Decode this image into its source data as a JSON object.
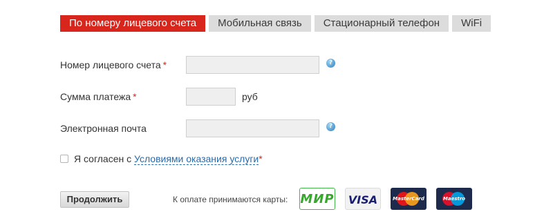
{
  "tabs": [
    {
      "label": "По номеру лицевого счета",
      "active": true
    },
    {
      "label": "Мобильная связь",
      "active": false
    },
    {
      "label": "Стационарный телефон",
      "active": false
    },
    {
      "label": "WiFi",
      "active": false
    }
  ],
  "form": {
    "account": {
      "label": "Номер лицевого счета",
      "required": "*",
      "value": ""
    },
    "amount": {
      "label": "Сумма платежа",
      "required": "*",
      "value": "",
      "unit": "руб"
    },
    "email": {
      "label": "Электронная почта",
      "value": ""
    },
    "help_glyph": "?"
  },
  "agreement": {
    "text": "Я согласен с",
    "link": "Условиями оказания услуги",
    "required": "*",
    "checked": false
  },
  "actions": {
    "continue_label": "Продолжить"
  },
  "payment": {
    "label": "К оплате принимаются карты:",
    "cards": {
      "mir": "МИР",
      "visa": "VISA",
      "mastercard": "MasterCard",
      "maestro": "Maestro"
    }
  },
  "colors": {
    "accent": "#d9261c",
    "tab_inactive": "#dcdcdc",
    "link": "#2a6aa8",
    "input_bg": "#efefef"
  },
  "icons": {
    "help": "help-icon",
    "checkbox": "checkbox-unchecked"
  }
}
